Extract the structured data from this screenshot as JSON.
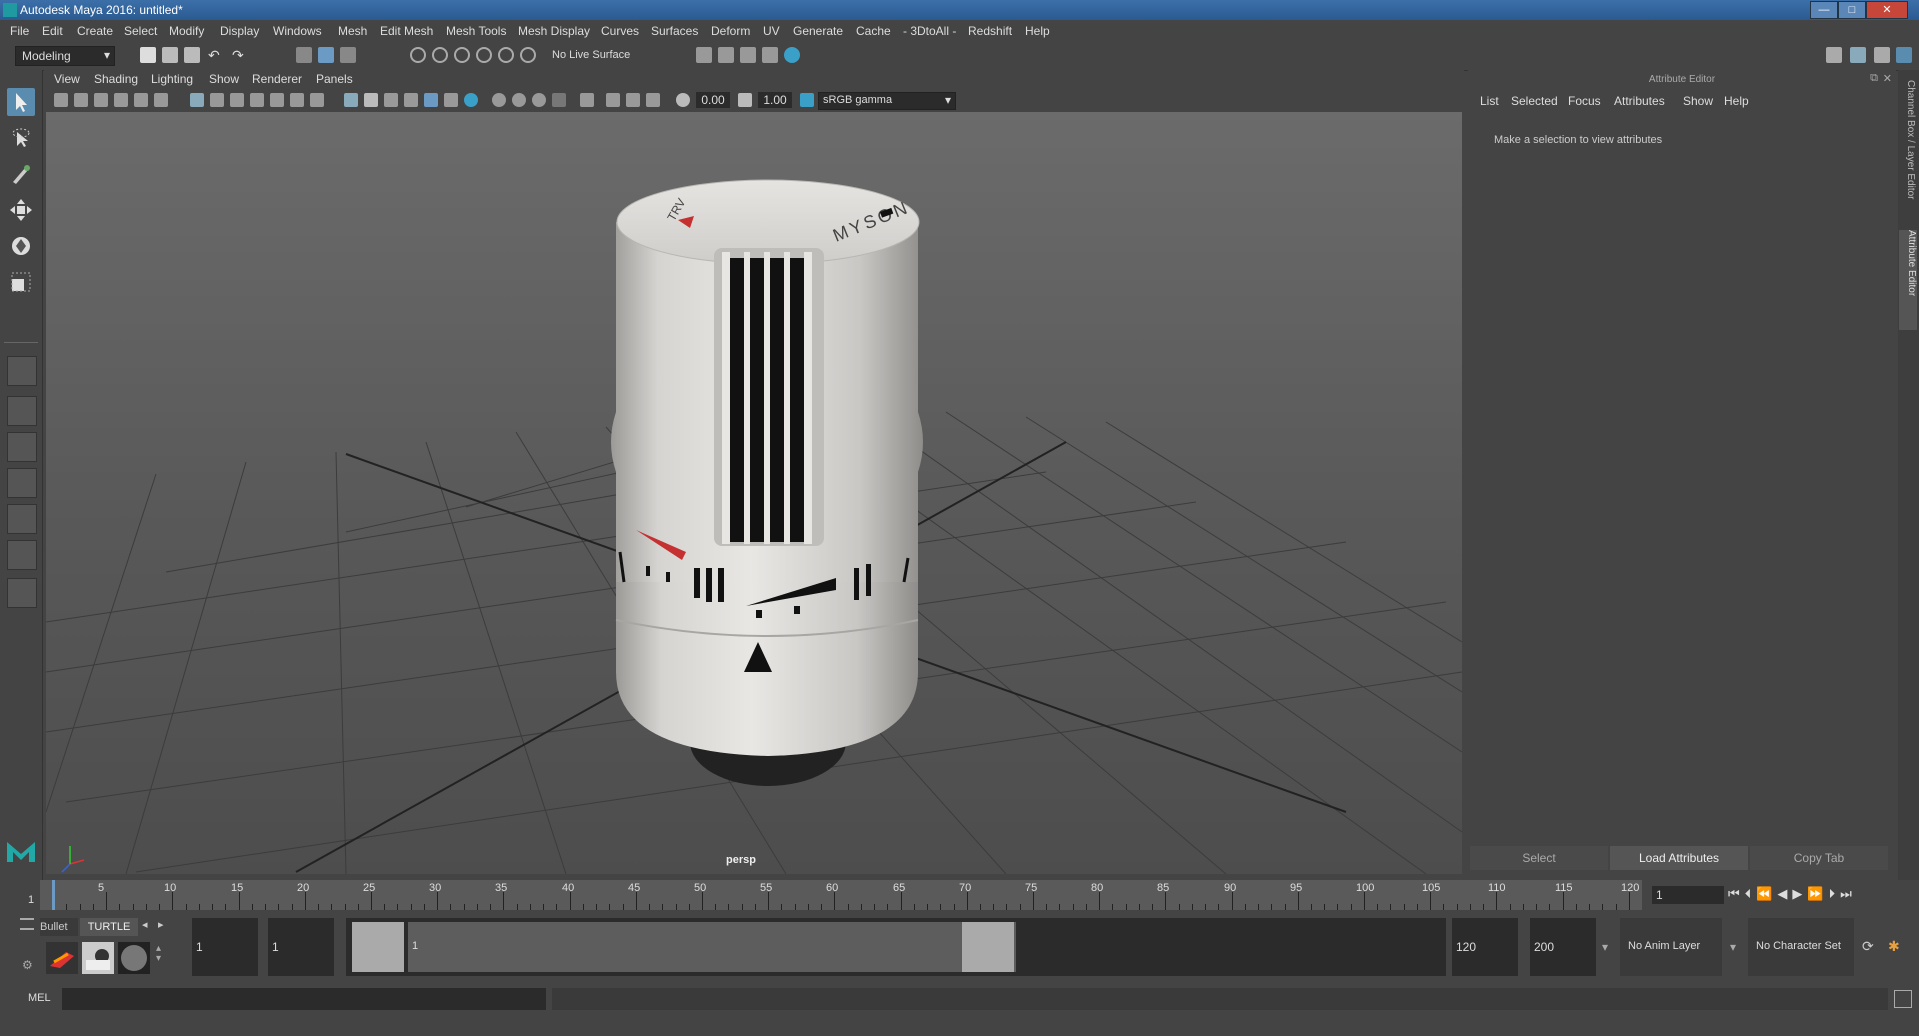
{
  "window": {
    "title": "Autodesk Maya 2016: untitled*",
    "minimize": "—",
    "maximize": "□",
    "close": "✕"
  },
  "menubar": [
    "File",
    "Edit",
    "Create",
    "Select",
    "Modify",
    "Display",
    "Windows",
    "Mesh",
    "Edit Mesh",
    "Mesh Tools",
    "Mesh Display",
    "Curves",
    "Surfaces",
    "Deform",
    "UV",
    "Generate",
    "Cache",
    "- 3DtoAll -",
    "Redshift",
    "Help"
  ],
  "toolbar": {
    "mode": "Modeling",
    "live_surface": "No Live Surface"
  },
  "viewport": {
    "menu": [
      "View",
      "Shading",
      "Lighting",
      "Show",
      "Renderer",
      "Panels"
    ],
    "exposure": "0.00",
    "gamma": "1.00",
    "color_space": "sRGB gamma",
    "camera_label": "persp",
    "model": {
      "brand": "MYSON",
      "left_text": "TRV"
    }
  },
  "attribute_editor": {
    "title": "Attribute Editor",
    "menu": [
      "List",
      "Selected",
      "Focus",
      "Attributes",
      "Show",
      "Help"
    ],
    "message": "Make a selection to view attributes",
    "buttons": {
      "select": "Select",
      "load": "Load Attributes",
      "copy": "Copy Tab"
    }
  },
  "side_tabs": {
    "channel_box": "Channel Box / Layer Editor",
    "attribute_editor": "Attribute Editor"
  },
  "timeline": {
    "ticks": [
      "5",
      "10",
      "15",
      "20",
      "25",
      "30",
      "35",
      "40",
      "45",
      "50",
      "55",
      "60",
      "65",
      "70",
      "75",
      "80",
      "85",
      "90",
      "95",
      "100",
      "105",
      "110",
      "115",
      "120"
    ],
    "start_marker": "1",
    "current_frame": "1"
  },
  "range": {
    "shelf_tabs": [
      "Bullet",
      "TURTLE"
    ],
    "start": "1",
    "playback_start": "1",
    "range_start_label": "1",
    "range_end_label": "120",
    "playback_end": "120",
    "end": "200",
    "anim_layer": "No Anim Layer",
    "character_set": "No Character Set"
  },
  "cmdline": {
    "label": "MEL"
  }
}
